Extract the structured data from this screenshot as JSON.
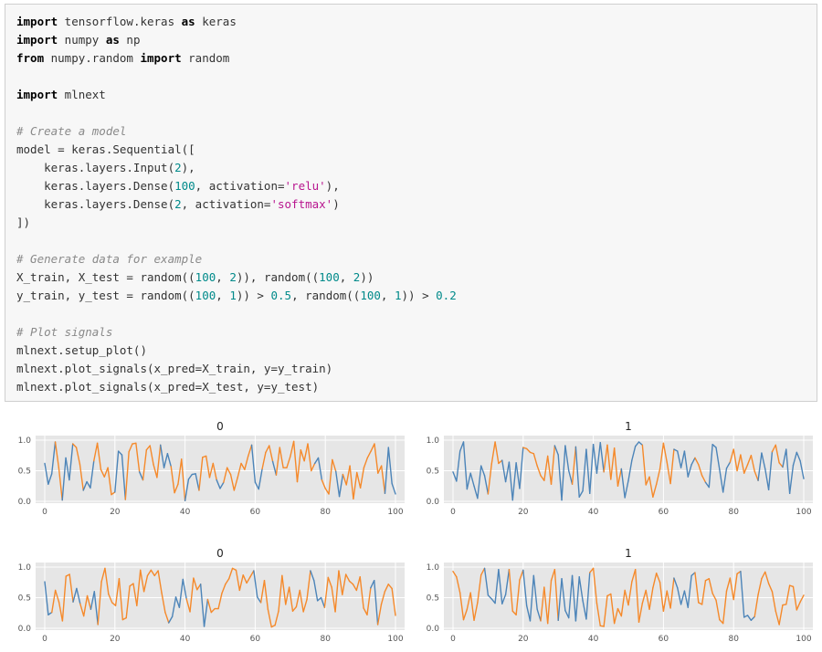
{
  "code_cell": {
    "lines": [
      [
        {
          "t": "import",
          "c": "kw"
        },
        {
          "t": " tensorflow.keras "
        },
        {
          "t": "as",
          "c": "kw"
        },
        {
          "t": " keras"
        }
      ],
      [
        {
          "t": "import",
          "c": "kw"
        },
        {
          "t": " numpy "
        },
        {
          "t": "as",
          "c": "kw"
        },
        {
          "t": " np"
        }
      ],
      [
        {
          "t": "from",
          "c": "kw"
        },
        {
          "t": " numpy.random "
        },
        {
          "t": "import",
          "c": "kw"
        },
        {
          "t": " random"
        }
      ],
      [],
      [
        {
          "t": "import",
          "c": "kw"
        },
        {
          "t": " mlnext"
        }
      ],
      [],
      [
        {
          "t": "# Create a model",
          "c": "cm"
        }
      ],
      [
        {
          "t": "model = keras.Sequential(["
        }
      ],
      [
        {
          "t": "    keras.layers.Input("
        },
        {
          "t": "2",
          "c": "num"
        },
        {
          "t": "),"
        }
      ],
      [
        {
          "t": "    keras.layers.Dense("
        },
        {
          "t": "100",
          "c": "num"
        },
        {
          "t": ", activation="
        },
        {
          "t": "'relu'",
          "c": "str"
        },
        {
          "t": "),"
        }
      ],
      [
        {
          "t": "    keras.layers.Dense("
        },
        {
          "t": "2",
          "c": "num"
        },
        {
          "t": ", activation="
        },
        {
          "t": "'softmax'",
          "c": "str"
        },
        {
          "t": ")"
        }
      ],
      [
        {
          "t": "])"
        }
      ],
      [],
      [
        {
          "t": "# Generate data for example",
          "c": "cm"
        }
      ],
      [
        {
          "t": "X_train, X_test = random(("
        },
        {
          "t": "100",
          "c": "num"
        },
        {
          "t": ", "
        },
        {
          "t": "2",
          "c": "num"
        },
        {
          "t": ")), random(("
        },
        {
          "t": "100",
          "c": "num"
        },
        {
          "t": ", "
        },
        {
          "t": "2",
          "c": "num"
        },
        {
          "t": "))"
        }
      ],
      [
        {
          "t": "y_train, y_test = random(("
        },
        {
          "t": "100",
          "c": "num"
        },
        {
          "t": ", "
        },
        {
          "t": "1",
          "c": "num"
        },
        {
          "t": ")) > "
        },
        {
          "t": "0.5",
          "c": "num"
        },
        {
          "t": ", random(("
        },
        {
          "t": "100",
          "c": "num"
        },
        {
          "t": ", "
        },
        {
          "t": "1",
          "c": "num"
        },
        {
          "t": ")) > "
        },
        {
          "t": "0.2",
          "c": "num"
        }
      ],
      [],
      [
        {
          "t": "# Plot signals",
          "c": "cm"
        }
      ],
      [
        {
          "t": "mlnext.setup_plot()"
        }
      ],
      [
        {
          "t": "mlnext.plot_signals(x_pred=X_train, y=y_train)"
        }
      ],
      [
        {
          "t": "mlnext.plot_signals(x_pred=X_test, y=y_test)"
        }
      ]
    ]
  },
  "output": {
    "colors": {
      "line_blue": "#4c84b8",
      "line_orange": "#f5892a",
      "plot_bg": "#e6e6e6",
      "grid": "#ffffff"
    },
    "x_ticks": [
      "0",
      "20",
      "40",
      "60",
      "80",
      "100"
    ],
    "y_ticks": [
      "0.0",
      "0.5",
      "1.0"
    ]
  },
  "chart_data": [
    {
      "type": "line",
      "title": "0",
      "xlim": [
        0,
        100
      ],
      "ylim": [
        0,
        1
      ],
      "x_ticks": [
        0,
        20,
        40,
        60,
        80,
        100
      ],
      "y_ticks": [
        0.0,
        0.5,
        1.0
      ],
      "grid": true,
      "values": [
        0.62,
        0.28,
        0.45,
        0.97,
        0.55,
        0.02,
        0.71,
        0.35,
        0.94,
        0.88,
        0.61,
        0.18,
        0.32,
        0.22,
        0.66,
        0.95,
        0.52,
        0.4,
        0.55,
        0.11,
        0.15,
        0.82,
        0.76,
        0.03,
        0.81,
        0.94,
        0.95,
        0.48,
        0.35,
        0.84,
        0.91,
        0.6,
        0.39,
        0.92,
        0.55,
        0.78,
        0.57,
        0.14,
        0.28,
        0.69,
        0.01,
        0.36,
        0.44,
        0.45,
        0.18,
        0.72,
        0.74,
        0.39,
        0.62,
        0.35,
        0.21,
        0.31,
        0.55,
        0.44,
        0.18,
        0.39,
        0.62,
        0.52,
        0.74,
        0.92,
        0.31,
        0.2,
        0.53,
        0.8,
        0.91,
        0.65,
        0.43,
        0.88,
        0.55,
        0.55,
        0.73,
        0.98,
        0.32,
        0.84,
        0.66,
        0.94,
        0.5,
        0.62,
        0.71,
        0.35,
        0.21,
        0.12,
        0.68,
        0.49,
        0.08,
        0.44,
        0.27,
        0.58,
        0.04,
        0.47,
        0.22,
        0.55,
        0.71,
        0.82,
        0.94,
        0.46,
        0.58,
        0.13,
        0.88,
        0.29,
        0.12
      ],
      "colored_by_label": true,
      "label_colors": {
        "false": "#4c84b8",
        "true": "#f5892a"
      },
      "labels": [
        0,
        0,
        0,
        1,
        1,
        0,
        0,
        0,
        1,
        1,
        1,
        0,
        0,
        0,
        1,
        1,
        1,
        1,
        1,
        1,
        0,
        0,
        0,
        1,
        1,
        1,
        1,
        0,
        1,
        1,
        1,
        1,
        1,
        0,
        0,
        0,
        1,
        1,
        1,
        1,
        0,
        0,
        0,
        0,
        1,
        1,
        1,
        1,
        1,
        0,
        0,
        1,
        1,
        1,
        1,
        1,
        1,
        1,
        1,
        0,
        0,
        0,
        1,
        1,
        1,
        0,
        1,
        1,
        1,
        1,
        1,
        1,
        1,
        1,
        1,
        1,
        1,
        0,
        0,
        1,
        1,
        1,
        1,
        0,
        0,
        1,
        1,
        1,
        1,
        1,
        1,
        1,
        1,
        1,
        1,
        1,
        1,
        0,
        0,
        0,
        0
      ]
    },
    {
      "type": "line",
      "title": "1",
      "xlim": [
        0,
        100
      ],
      "ylim": [
        0,
        1
      ],
      "x_ticks": [
        0,
        20,
        40,
        60,
        80,
        100
      ],
      "y_ticks": [
        0.0,
        0.5,
        1.0
      ],
      "grid": true,
      "values": [
        0.48,
        0.33,
        0.82,
        0.97,
        0.2,
        0.46,
        0.25,
        0.05,
        0.58,
        0.42,
        0.12,
        0.61,
        0.97,
        0.62,
        0.67,
        0.32,
        0.64,
        0.02,
        0.63,
        0.21,
        0.88,
        0.86,
        0.8,
        0.78,
        0.58,
        0.42,
        0.34,
        0.74,
        0.28,
        0.91,
        0.76,
        0.02,
        0.91,
        0.5,
        0.28,
        0.89,
        0.07,
        0.17,
        0.85,
        0.13,
        0.93,
        0.46,
        0.96,
        0.48,
        0.92,
        0.36,
        0.87,
        0.25,
        0.53,
        0.06,
        0.34,
        0.67,
        0.9,
        0.97,
        0.92,
        0.27,
        0.4,
        0.07,
        0.28,
        0.53,
        0.95,
        0.64,
        0.29,
        0.85,
        0.82,
        0.55,
        0.82,
        0.4,
        0.6,
        0.71,
        0.6,
        0.42,
        0.31,
        0.23,
        0.93,
        0.88,
        0.52,
        0.15,
        0.54,
        0.64,
        0.85,
        0.5,
        0.76,
        0.46,
        0.6,
        0.75,
        0.49,
        0.34,
        0.79,
        0.53,
        0.19,
        0.81,
        0.92,
        0.63,
        0.56,
        0.85,
        0.13,
        0.59,
        0.8,
        0.66,
        0.37
      ],
      "colored_by_label": true,
      "label_colors": {
        "false": "#4c84b8",
        "true": "#f5892a"
      },
      "labels": [
        0,
        0,
        0,
        0,
        0,
        0,
        0,
        0,
        0,
        0,
        1,
        1,
        1,
        1,
        0,
        0,
        0,
        0,
        0,
        0,
        1,
        1,
        1,
        1,
        1,
        1,
        1,
        1,
        1,
        0,
        0,
        0,
        0,
        0,
        1,
        0,
        0,
        0,
        0,
        0,
        0,
        0,
        0,
        1,
        1,
        1,
        1,
        1,
        0,
        0,
        0,
        0,
        0,
        0,
        1,
        1,
        1,
        1,
        1,
        1,
        1,
        1,
        1,
        0,
        0,
        0,
        0,
        0,
        0,
        1,
        1,
        1,
        0,
        0,
        0,
        0,
        0,
        0,
        0,
        1,
        1,
        1,
        1,
        1,
        1,
        1,
        1,
        0,
        0,
        0,
        0,
        1,
        1,
        1,
        0,
        0,
        0,
        0,
        0,
        0,
        0
      ]
    },
    {
      "type": "line",
      "title": "0",
      "xlim": [
        0,
        100
      ],
      "ylim": [
        0,
        1
      ],
      "x_ticks": [
        0,
        20,
        40,
        60,
        80,
        100
      ],
      "y_ticks": [
        0.0,
        0.5,
        1.0
      ],
      "grid": true,
      "values": [
        0.76,
        0.22,
        0.26,
        0.62,
        0.43,
        0.12,
        0.85,
        0.88,
        0.43,
        0.65,
        0.4,
        0.2,
        0.53,
        0.31,
        0.6,
        0.06,
        0.76,
        0.98,
        0.56,
        0.42,
        0.37,
        0.81,
        0.14,
        0.17,
        0.69,
        0.73,
        0.37,
        0.95,
        0.6,
        0.86,
        0.95,
        0.86,
        0.94,
        0.58,
        0.26,
        0.09,
        0.19,
        0.51,
        0.34,
        0.8,
        0.48,
        0.27,
        0.82,
        0.63,
        0.72,
        0.03,
        0.47,
        0.26,
        0.32,
        0.32,
        0.57,
        0.72,
        0.81,
        0.98,
        0.95,
        0.62,
        0.87,
        0.74,
        0.84,
        0.94,
        0.51,
        0.42,
        0.78,
        0.31,
        0.02,
        0.05,
        0.28,
        0.86,
        0.39,
        0.67,
        0.28,
        0.35,
        0.62,
        0.27,
        0.47,
        0.94,
        0.78,
        0.45,
        0.5,
        0.34,
        0.83,
        0.67,
        0.27,
        0.94,
        0.55,
        0.88,
        0.77,
        0.72,
        0.62,
        0.84,
        0.33,
        0.22,
        0.66,
        0.78,
        0.06,
        0.39,
        0.6,
        0.72,
        0.65,
        0.21
      ],
      "colored_by_label": true,
      "label_colors": {
        "false": "#4c84b8",
        "true": "#f5892a"
      },
      "labels": [
        0,
        0,
        1,
        1,
        1,
        1,
        1,
        1,
        0,
        0,
        1,
        1,
        1,
        0,
        0,
        1,
        1,
        1,
        1,
        1,
        1,
        1,
        1,
        1,
        1,
        1,
        1,
        1,
        1,
        1,
        1,
        1,
        1,
        1,
        1,
        0,
        0,
        0,
        0,
        0,
        1,
        1,
        1,
        1,
        0,
        0,
        1,
        1,
        1,
        1,
        1,
        1,
        1,
        1,
        1,
        1,
        1,
        1,
        1,
        0,
        0,
        1,
        1,
        1,
        1,
        1,
        1,
        1,
        1,
        1,
        1,
        1,
        1,
        1,
        1,
        0,
        0,
        0,
        0,
        1,
        1,
        1,
        1,
        1,
        1,
        1,
        1,
        1,
        1,
        1,
        1,
        1,
        0,
        0,
        1,
        1,
        1,
        1,
        1,
        1
      ]
    },
    {
      "type": "line",
      "title": "1",
      "xlim": [
        0,
        100
      ],
      "ylim": [
        0,
        1
      ],
      "x_ticks": [
        0,
        20,
        40,
        60,
        80,
        100
      ],
      "y_ticks": [
        0.0,
        0.5,
        1.0
      ],
      "grid": true,
      "values": [
        0.93,
        0.84,
        0.58,
        0.14,
        0.31,
        0.58,
        0.13,
        0.42,
        0.87,
        0.98,
        0.54,
        0.48,
        0.41,
        0.96,
        0.4,
        0.55,
        0.96,
        0.28,
        0.22,
        0.79,
        0.95,
        0.37,
        0.12,
        0.86,
        0.31,
        0.12,
        0.67,
        0.08,
        0.78,
        0.96,
        0.13,
        0.81,
        0.29,
        0.17,
        0.86,
        0.12,
        0.84,
        0.45,
        0.15,
        0.91,
        0.98,
        0.41,
        0.04,
        0.03,
        0.53,
        0.56,
        0.08,
        0.32,
        0.2,
        0.62,
        0.38,
        0.76,
        0.96,
        0.1,
        0.41,
        0.62,
        0.31,
        0.66,
        0.9,
        0.75,
        0.28,
        0.61,
        0.33,
        0.82,
        0.66,
        0.39,
        0.61,
        0.34,
        0.86,
        0.91,
        0.42,
        0.39,
        0.78,
        0.81,
        0.57,
        0.46,
        0.14,
        0.08,
        0.61,
        0.82,
        0.47,
        0.89,
        0.93,
        0.18,
        0.21,
        0.13,
        0.19,
        0.55,
        0.81,
        0.92,
        0.73,
        0.6,
        0.28,
        0.06,
        0.38,
        0.39,
        0.7,
        0.68,
        0.3,
        0.43,
        0.54
      ],
      "colored_by_label": true,
      "label_colors": {
        "false": "#4c84b8",
        "true": "#f5892a"
      },
      "labels": [
        1,
        1,
        1,
        1,
        1,
        1,
        1,
        1,
        1,
        0,
        0,
        0,
        0,
        0,
        0,
        0,
        1,
        1,
        1,
        1,
        0,
        0,
        0,
        0,
        0,
        1,
        1,
        1,
        1,
        1,
        0,
        0,
        0,
        0,
        0,
        0,
        0,
        0,
        0,
        1,
        1,
        1,
        1,
        1,
        1,
        1,
        1,
        1,
        1,
        1,
        1,
        1,
        1,
        1,
        1,
        1,
        1,
        1,
        1,
        1,
        1,
        1,
        1,
        0,
        0,
        0,
        0,
        0,
        0,
        1,
        1,
        1,
        1,
        1,
        1,
        1,
        1,
        1,
        1,
        1,
        1,
        1,
        0,
        0,
        0,
        0,
        1,
        1,
        1,
        1,
        1,
        1,
        1,
        1,
        1,
        1,
        1,
        1,
        1,
        1,
        1
      ]
    }
  ]
}
